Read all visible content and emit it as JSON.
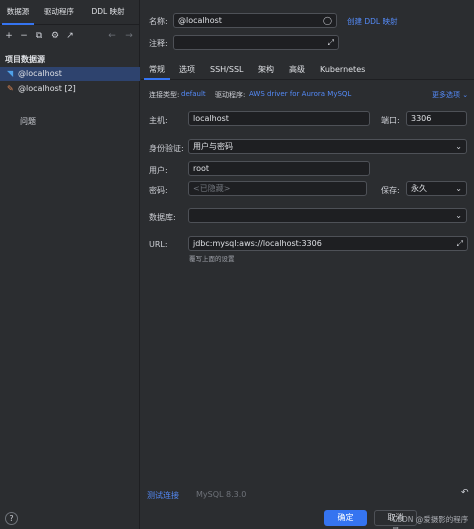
{
  "left": {
    "tabs": [
      "数据源",
      "驱动程序",
      "DDL 映射"
    ],
    "toolbar": {
      "add": "+",
      "remove": "−",
      "copy": "⧉",
      "settings": "⚙",
      "export": "↗",
      "back": "←",
      "forward": "→"
    },
    "section_title": "项目数据源",
    "items": [
      {
        "label": "@localhost",
        "icon": "◥"
      },
      {
        "label": "@localhost [2]",
        "icon": "✎"
      }
    ],
    "problems": "问题",
    "help": "?"
  },
  "form": {
    "name_label": "名称:",
    "name_value": "@localhost",
    "create_ddl_link": "创建 DDL 映射",
    "comment_label": "注释:",
    "tabs": [
      "常规",
      "选项",
      "SSH/SSL",
      "架构",
      "高级",
      "Kubernetes"
    ],
    "conn_type_label": "连接类型:",
    "conn_type_value": "default",
    "driver_label": "驱动程序:",
    "driver_value": "AWS driver for Aurora MySQL",
    "more_options": "更多选项",
    "host_label": "主机:",
    "host_value": "localhost",
    "port_label": "端口:",
    "port_value": "3306",
    "auth_label": "身份验证:",
    "auth_value": "用户与密码",
    "user_label": "用户:",
    "user_value": "root",
    "password_label": "密码:",
    "password_placeholder": "<已隐藏>",
    "save_label": "保存:",
    "save_value": "永久",
    "database_label": "数据库:",
    "database_value": "",
    "url_label": "URL:",
    "url_value": "jdbc:mysql:aws://localhost:3306",
    "url_hint": "覆写上面的设置"
  },
  "bottom": {
    "test_connection": "测试连接",
    "version": "MySQL 8.3.0",
    "revert": "↶"
  },
  "footer": {
    "ok": "确定",
    "cancel": "取消",
    "watermark": "CSDN @爱摄影的程序员"
  }
}
